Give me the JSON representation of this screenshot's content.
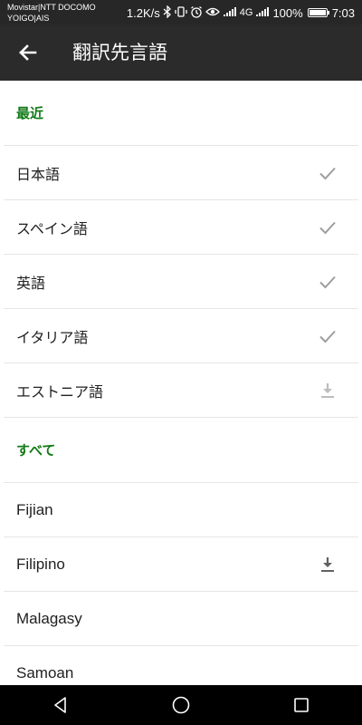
{
  "status_bar": {
    "carrier_line1": "Movistar|NTT DOCOMO",
    "carrier_line2": "YOIGO|AIS",
    "speed": "1.2K/s",
    "signal_label": "4G",
    "battery_percent": "100%",
    "battery_level": 1.0,
    "time": "7:03"
  },
  "app_bar": {
    "title": "翻訳先言語"
  },
  "sections": {
    "recent": {
      "header": "最近",
      "items": [
        {
          "label": "日本語",
          "status": "check"
        },
        {
          "label": "スペイン語",
          "status": "check"
        },
        {
          "label": "英語",
          "status": "check"
        },
        {
          "label": "イタリア語",
          "status": "check"
        },
        {
          "label": "エストニア語",
          "status": "download"
        }
      ]
    },
    "all": {
      "header": "すべて",
      "items": [
        {
          "label": "Fijian",
          "status": "none"
        },
        {
          "label": "Filipino",
          "status": "download"
        },
        {
          "label": "Malagasy",
          "status": "none"
        },
        {
          "label": "Samoan",
          "status": "none"
        }
      ]
    }
  },
  "colors": {
    "section_header": "#137a18",
    "check_icon": "#9e9e9e",
    "download_icon_light": "#bdbdbd",
    "download_icon_dark": "#616161"
  }
}
